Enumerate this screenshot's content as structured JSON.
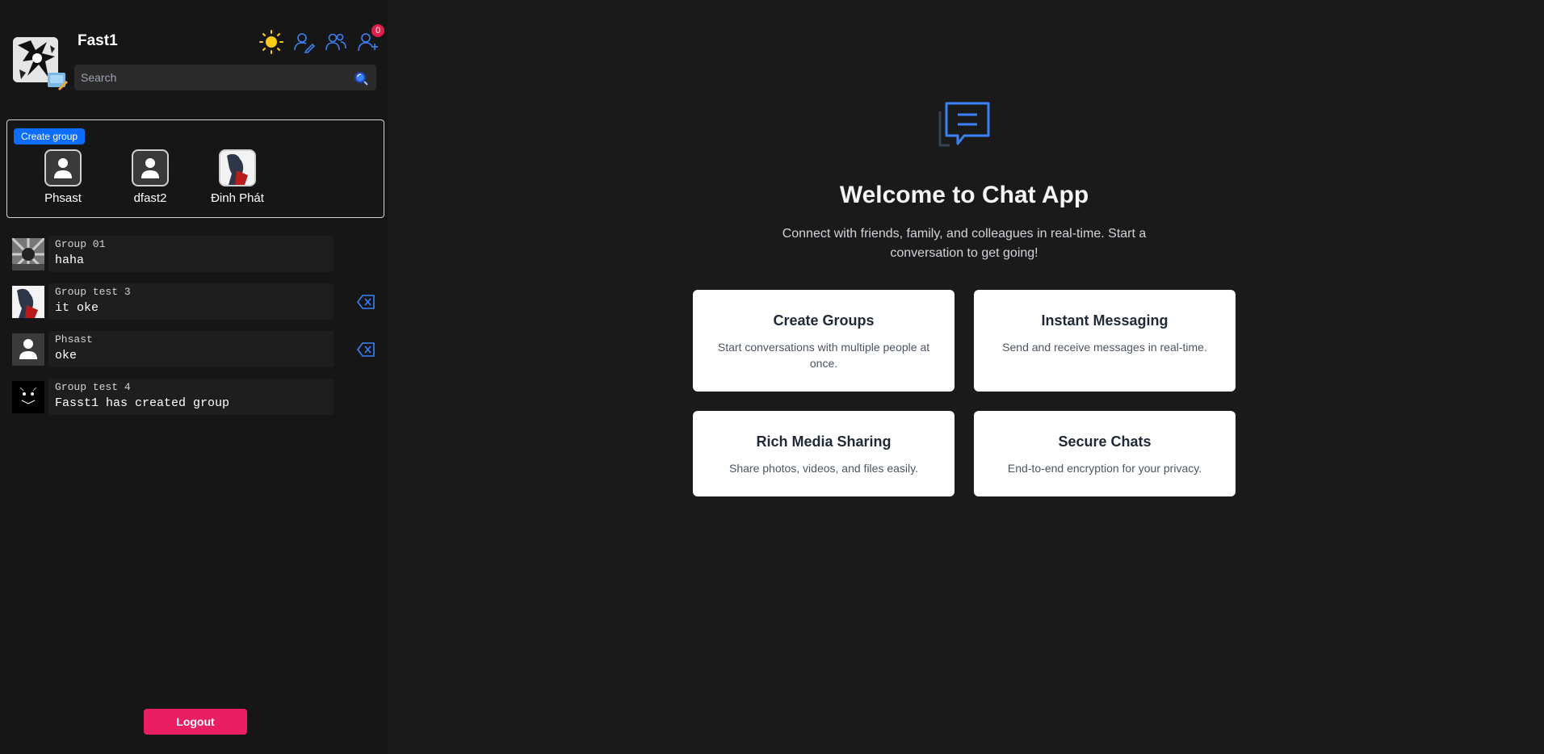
{
  "user": {
    "name": "Fast1"
  },
  "header": {
    "notification_count": "0"
  },
  "search": {
    "placeholder": "Search"
  },
  "groups": {
    "create_label": "Create group",
    "members": [
      {
        "name": "Phsast"
      },
      {
        "name": "dfast2"
      },
      {
        "name": "Đinh Phát"
      }
    ]
  },
  "conversations": [
    {
      "title": "Group 01",
      "message": "haha"
    },
    {
      "title": "Group test 3",
      "message": "it oke"
    },
    {
      "title": "Phsast",
      "message": "oke"
    },
    {
      "title": "Group test 4",
      "message": "Fasst1 has created group"
    }
  ],
  "logout_label": "Logout",
  "main": {
    "title": "Welcome to Chat App",
    "subtitle": "Connect with friends, family, and colleagues in real-time. Start a conversation to get going!",
    "cards": [
      {
        "title": "Create Groups",
        "desc": "Start conversations with multiple people at once."
      },
      {
        "title": "Instant Messaging",
        "desc": "Send and receive messages in real-time."
      },
      {
        "title": "Rich Media Sharing",
        "desc": "Share photos, videos, and files easily."
      },
      {
        "title": "Secure Chats",
        "desc": "End-to-end encryption for your privacy."
      }
    ]
  },
  "colors": {
    "accent": "#0d6efd",
    "logout": "#e91e63",
    "badge": "#e11d48",
    "icon_blue": "#3b82f6"
  },
  "icons": [
    "sun-icon",
    "edit-user-icon",
    "users-icon",
    "add-user-icon",
    "search-icon",
    "delete-icon",
    "chat-icon"
  ]
}
